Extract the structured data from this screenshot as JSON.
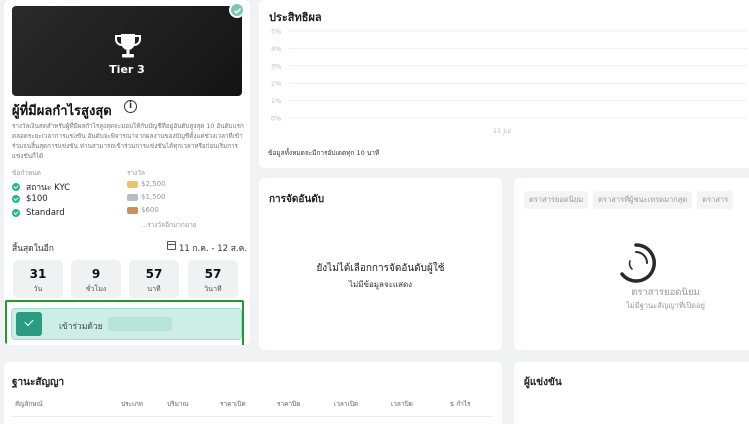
{
  "tier": {
    "label": "Tier 3",
    "icon": "trophy-icon"
  },
  "competition": {
    "title": "ผู้ที่มีผลกำไรสูงสุด",
    "description": "รางวัลเงินสดสำหรับผู้ที่มีผลกำไรสูงสุดจะมอบให้กับบัญชีที่อยู่อันดับสูงสุด 10 อันดับแรกตลอดระยะเวลาการแข่งขัน อันดับจะพิจารณาจากผลงานของบัญชีตั้งแต่ช่วงเวลาที่เข้าร่วมจนสิ้นสุดการแข่งขัน ท่านสามารถเข้าร่วมการแข่งขันได้ทุกเวลาหรือก่อนเริ่มการแข่งขันก็ได้",
    "requirements_label": "ข้อกำหนด",
    "requirements": [
      "สถานะ KYC",
      "$100",
      "Standard"
    ],
    "rewards_label": "รางวัล",
    "rewards": [
      {
        "amount": "$2,500",
        "color": "#e9c46a"
      },
      {
        "amount": "$1,500",
        "color": "#b8bcc4"
      },
      {
        "amount": "$600",
        "color": "#c9905a"
      }
    ],
    "rewards_more": "...รางวัลอีกมากมาย",
    "ends_label": "สิ้นสุดในอีก",
    "date_range": "11 ก.ค. - 12 ส.ค.",
    "countdown": [
      {
        "value": "31",
        "unit": "วัน"
      },
      {
        "value": "9",
        "unit": "ชั่วโมง"
      },
      {
        "value": "57",
        "unit": "นาที"
      },
      {
        "value": "57",
        "unit": "วินาที"
      }
    ],
    "join_label": "เข้าร่วมด้วย"
  },
  "performance": {
    "title": "ประสิทธิผล",
    "note": "ข้อมูลทั้งหมดจะมีการอัปเดตทุก 10 นาที"
  },
  "chart_data": {
    "type": "line",
    "title": "ประสิทธิผล",
    "y_ticks": [
      "5%",
      "4%",
      "3%",
      "2%",
      "1%",
      "0%"
    ],
    "ylim": [
      0,
      5
    ],
    "x_ticks": [
      "11 Jul"
    ],
    "series": [],
    "grid": true
  },
  "ranking": {
    "title": "การจัดอันดับ",
    "empty_title": "ยังไม่ได้เลือกการจัดอันดับผู้ใช้",
    "empty_sub": "ไม่มีข้อมูลจะแสดง"
  },
  "contracts_tabs": {
    "tabs": [
      "ตราสารยอดนิยม",
      "ตราสารที่ผู้ชนะเทรดมากสุด",
      "ตราสาร"
    ],
    "empty_title": "ตราสารยอดนิยม",
    "empty_sub": "ไม่มีฐานะสัญญาที่เปิดอยู่"
  },
  "positions": {
    "title": "ฐานะสัญญา",
    "columns": [
      "สัญลักษณ์",
      "ประเภท",
      "ปริมาณ",
      "ราคาเปิด",
      "ราคาปิด",
      "เวลาเปิด",
      "เวลาปิด",
      "$ กำไร"
    ]
  },
  "competitors": {
    "title": "ผู้แข่งขัน"
  }
}
